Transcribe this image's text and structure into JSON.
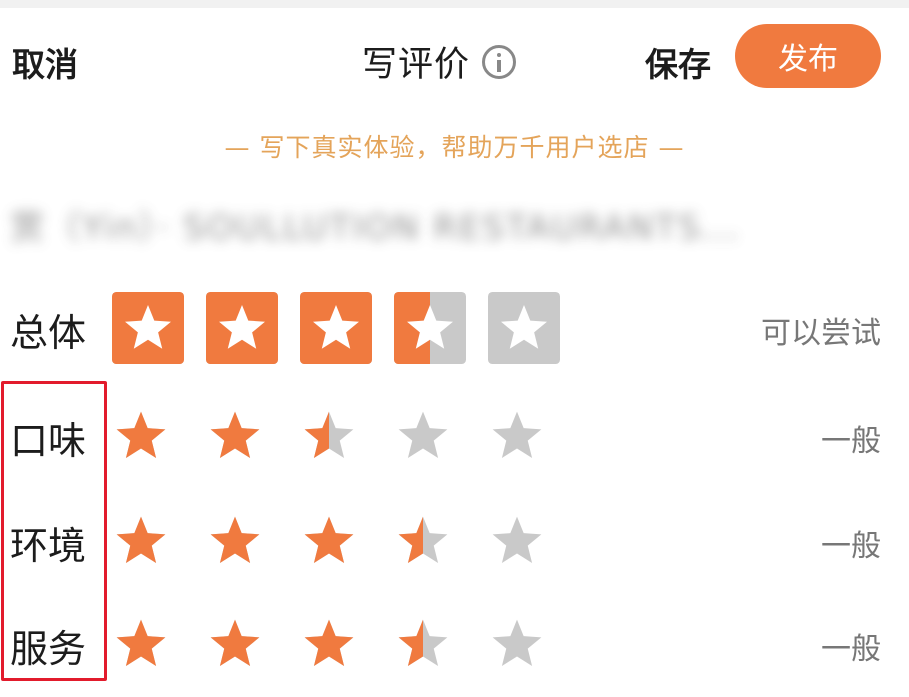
{
  "header": {
    "cancel_label": "取消",
    "title": "写评价",
    "save_label": "保存",
    "publish_label": "发布"
  },
  "tagline": "— 写下真实体验，帮助万千用户选店 —",
  "restaurant_name": "赏（Yin）· SOULLUTION RESTAURANTS...",
  "colors": {
    "accent": "#f07a3f",
    "empty_star": "#c9c9c9",
    "tagline": "#e4a45a",
    "highlight": "#e21b2c"
  },
  "ratings": {
    "overall": {
      "label": "总体",
      "value": 3.5,
      "max": 5,
      "description": "可以尝试"
    },
    "items": [
      {
        "label": "口味",
        "value": 2.5,
        "max": 5,
        "description": "一般"
      },
      {
        "label": "环境",
        "value": 3.5,
        "max": 5,
        "description": "一般"
      },
      {
        "label": "服务",
        "value": 3.5,
        "max": 5,
        "description": "一般"
      }
    ]
  },
  "icons": {
    "info": "info-icon",
    "star": "star-icon"
  }
}
